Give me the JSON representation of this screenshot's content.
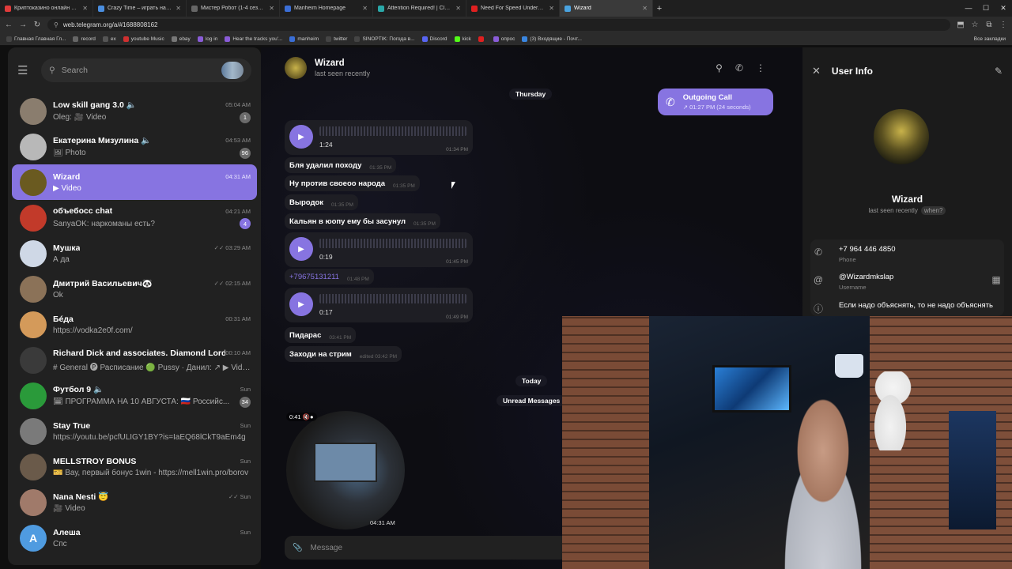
{
  "browser": {
    "tabs": [
      {
        "title": "Криптоказино онлайн VAVADA",
        "color": "#e03b3b"
      },
      {
        "title": "Crazy Time – играть на офиц.",
        "color": "#4a8ee0"
      },
      {
        "title": "Мистер Робот (1-4 сезон) смо",
        "color": "#666666"
      },
      {
        "title": "Manheim Homepage",
        "color": "#3b6ed6"
      },
      {
        "title": "Attention Required! | Cloudflare",
        "color": "#2aa8a8"
      },
      {
        "title": "Need For Speed Underground",
        "color": "#e02020"
      },
      {
        "title": "Wizard",
        "color": "#4aa3e0"
      }
    ],
    "url": "web.telegram.org/a/#1688808162",
    "bookmarks": [
      "Главная Главная Гл...",
      "record",
      "ex",
      "youtube Music",
      "ebay",
      "log in",
      "Hear the tracks you'...",
      "manheim",
      "twitter",
      "SINOPTIK: Погода в...",
      "Discord",
      "kick",
      "",
      "опрос",
      "(3) Входящие - Почт..."
    ],
    "all_bookmarks": "Все закладки"
  },
  "sidebar": {
    "search_placeholder": "Search",
    "chats": [
      {
        "name": "Low skill gang 3.0 🔈",
        "time": "05:04 AM",
        "msg": "Oleg: 🎥 Video",
        "badge": "1",
        "color": "#8a7d6e",
        "initial": ""
      },
      {
        "name": "Екатерина Мизулина 🔈",
        "time": "04:53 AM",
        "msg": "🖼 Photo",
        "badge": "96",
        "color": "#b8b8b8",
        "initial": ""
      },
      {
        "name": "Wizard",
        "time": "04:31 AM",
        "msg": "▶ Video",
        "badge": "",
        "color": "#6a5a20",
        "initial": "",
        "active": true
      },
      {
        "name": "объебосс chat",
        "time": "04:21 AM",
        "msg": "SanyaOK: наркоманы есть?",
        "badge": "4",
        "color": "#c23a2a",
        "initial": "",
        "accent": true
      },
      {
        "name": "Мушка",
        "time": "✓✓ 03:29 AM",
        "msg": "А да",
        "badge": "",
        "color": "#cfd8e6",
        "initial": ""
      },
      {
        "name": "Дмитрий Васильевич🐼",
        "time": "✓✓ 02:15 AM",
        "msg": "Ok",
        "badge": "",
        "color": "#8b7258",
        "initial": ""
      },
      {
        "name": "Бéда",
        "time": "00:31 AM",
        "msg": "https://vodka2e0f.com/",
        "badge": "",
        "color": "#d49a5a",
        "initial": ""
      },
      {
        "name": "Richard Dick and associates. Diamond Lords. 🔈",
        "time": "00:10 AM",
        "msg": "# General 🅟 Расписание 🟢 Pussy · Данил: ↗ ▶ Video",
        "badge": "",
        "color": "#3a3a3a",
        "initial": ""
      },
      {
        "name": "Футбол 9 🔈",
        "time": "Sun",
        "msg": "🗓 ПРОГРАММА НА 10 АВГУСТА: 🇷🇺 Российс...",
        "badge": "34",
        "color": "#2a9a3a",
        "initial": ""
      },
      {
        "name": "Stay True",
        "time": "Sun",
        "msg": "https://youtu.be/pcfULIGY1BY?is=IaEQ68lCkT9aEm4g",
        "badge": "",
        "color": "#7a7a7a",
        "initial": ""
      },
      {
        "name": "MELLSTROY BONUS",
        "time": "Sun",
        "msg": "🎫 Вау, первый бонус 1win - https://mell1win.pro/borov",
        "badge": "",
        "color": "#6a5a4a",
        "initial": ""
      },
      {
        "name": "Nana Nesti 😇",
        "time": "✓✓ Sun",
        "msg": "🎥 Video",
        "badge": "",
        "color": "#a07a6a",
        "initial": ""
      },
      {
        "name": "Алеша",
        "time": "Sun",
        "msg": "Спс",
        "badge": "",
        "color": "#4f9be0",
        "initial": "А"
      }
    ]
  },
  "chat": {
    "name": "Wizard",
    "status": "last seen recently",
    "date_thursday": "Thursday",
    "date_today": "Today",
    "unread": "Unread Messages",
    "outgoing_call": {
      "title": "Outgoing Call",
      "sub": "↗ 01:27 PM (24 seconds)"
    },
    "voice": [
      {
        "dur": "1:24",
        "time": "01:34 PM"
      },
      {
        "dur": "0:19",
        "time": "01:45 PM"
      },
      {
        "dur": "0:17",
        "time": "01:49 PM"
      }
    ],
    "messages": [
      {
        "text": "Бля удалил походу",
        "time": "01:35 PM"
      },
      {
        "text": "Ну против своеоо народа",
        "time": "01:35 PM"
      },
      {
        "text": "Выродок",
        "time": "01:35 PM"
      },
      {
        "text": "Кальян в юопу ему бы засунул",
        "time": "01:35 PM"
      },
      {
        "text": "+79675131211",
        "time": "01:48 PM"
      },
      {
        "text": "Пидарас",
        "time": "03:41 PM"
      },
      {
        "text": "Заходи на стрим",
        "time": "edited 03:42 PM"
      }
    ],
    "round_video": {
      "dur": "0:41 🔇●",
      "time": "04:31 AM"
    },
    "composer_placeholder": "Message"
  },
  "user_info": {
    "title": "User Info",
    "name": "Wizard",
    "status": "last seen recently",
    "when": "when?",
    "phone": "+7 964 446 4850",
    "phone_label": "Phone",
    "username": "@Wizardmkslap",
    "username_label": "Username",
    "bio": "Если надо объяснять, то не надо объяснять"
  }
}
